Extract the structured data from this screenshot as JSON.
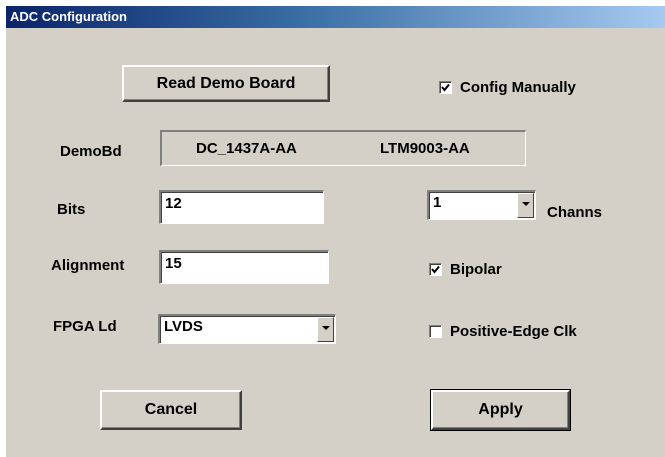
{
  "window": {
    "title": "ADC Configuration"
  },
  "buttons": {
    "read_demo_board": "Read Demo Board",
    "cancel": "Cancel",
    "apply": "Apply"
  },
  "checkboxes": {
    "config_manually": {
      "label": "Config Manually",
      "checked": true
    },
    "bipolar": {
      "label": "Bipolar",
      "checked": true
    },
    "positive_edge_clk": {
      "label": "Positive-Edge Clk",
      "checked": false
    }
  },
  "demobd": {
    "label": "DemoBd",
    "board": "DC_1437A-AA",
    "part": "LTM9003-AA"
  },
  "bits": {
    "label": "Bits",
    "value": "12"
  },
  "alignment": {
    "label": "Alignment",
    "value": "15"
  },
  "fpga_ld": {
    "label": "FPGA Ld",
    "selected": "LVDS"
  },
  "channs": {
    "label": "Channs",
    "selected": "1"
  },
  "icons": {
    "dropdown": "chevron-down-icon",
    "check": "checkmark-icon"
  }
}
